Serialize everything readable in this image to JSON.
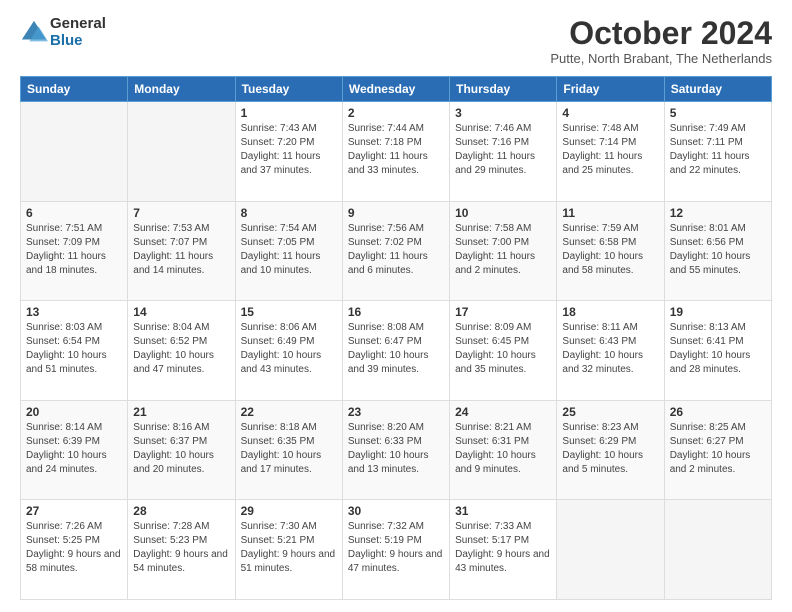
{
  "logo": {
    "general": "General",
    "blue": "Blue"
  },
  "title": "October 2024",
  "subtitle": "Putte, North Brabant, The Netherlands",
  "days_of_week": [
    "Sunday",
    "Monday",
    "Tuesday",
    "Wednesday",
    "Thursday",
    "Friday",
    "Saturday"
  ],
  "weeks": [
    [
      {
        "day": "",
        "sunrise": "",
        "sunset": "",
        "daylight": ""
      },
      {
        "day": "",
        "sunrise": "",
        "sunset": "",
        "daylight": ""
      },
      {
        "day": "1",
        "sunrise": "Sunrise: 7:43 AM",
        "sunset": "Sunset: 7:20 PM",
        "daylight": "Daylight: 11 hours and 37 minutes."
      },
      {
        "day": "2",
        "sunrise": "Sunrise: 7:44 AM",
        "sunset": "Sunset: 7:18 PM",
        "daylight": "Daylight: 11 hours and 33 minutes."
      },
      {
        "day": "3",
        "sunrise": "Sunrise: 7:46 AM",
        "sunset": "Sunset: 7:16 PM",
        "daylight": "Daylight: 11 hours and 29 minutes."
      },
      {
        "day": "4",
        "sunrise": "Sunrise: 7:48 AM",
        "sunset": "Sunset: 7:14 PM",
        "daylight": "Daylight: 11 hours and 25 minutes."
      },
      {
        "day": "5",
        "sunrise": "Sunrise: 7:49 AM",
        "sunset": "Sunset: 7:11 PM",
        "daylight": "Daylight: 11 hours and 22 minutes."
      }
    ],
    [
      {
        "day": "6",
        "sunrise": "Sunrise: 7:51 AM",
        "sunset": "Sunset: 7:09 PM",
        "daylight": "Daylight: 11 hours and 18 minutes."
      },
      {
        "day": "7",
        "sunrise": "Sunrise: 7:53 AM",
        "sunset": "Sunset: 7:07 PM",
        "daylight": "Daylight: 11 hours and 14 minutes."
      },
      {
        "day": "8",
        "sunrise": "Sunrise: 7:54 AM",
        "sunset": "Sunset: 7:05 PM",
        "daylight": "Daylight: 11 hours and 10 minutes."
      },
      {
        "day": "9",
        "sunrise": "Sunrise: 7:56 AM",
        "sunset": "Sunset: 7:02 PM",
        "daylight": "Daylight: 11 hours and 6 minutes."
      },
      {
        "day": "10",
        "sunrise": "Sunrise: 7:58 AM",
        "sunset": "Sunset: 7:00 PM",
        "daylight": "Daylight: 11 hours and 2 minutes."
      },
      {
        "day": "11",
        "sunrise": "Sunrise: 7:59 AM",
        "sunset": "Sunset: 6:58 PM",
        "daylight": "Daylight: 10 hours and 58 minutes."
      },
      {
        "day": "12",
        "sunrise": "Sunrise: 8:01 AM",
        "sunset": "Sunset: 6:56 PM",
        "daylight": "Daylight: 10 hours and 55 minutes."
      }
    ],
    [
      {
        "day": "13",
        "sunrise": "Sunrise: 8:03 AM",
        "sunset": "Sunset: 6:54 PM",
        "daylight": "Daylight: 10 hours and 51 minutes."
      },
      {
        "day": "14",
        "sunrise": "Sunrise: 8:04 AM",
        "sunset": "Sunset: 6:52 PM",
        "daylight": "Daylight: 10 hours and 47 minutes."
      },
      {
        "day": "15",
        "sunrise": "Sunrise: 8:06 AM",
        "sunset": "Sunset: 6:49 PM",
        "daylight": "Daylight: 10 hours and 43 minutes."
      },
      {
        "day": "16",
        "sunrise": "Sunrise: 8:08 AM",
        "sunset": "Sunset: 6:47 PM",
        "daylight": "Daylight: 10 hours and 39 minutes."
      },
      {
        "day": "17",
        "sunrise": "Sunrise: 8:09 AM",
        "sunset": "Sunset: 6:45 PM",
        "daylight": "Daylight: 10 hours and 35 minutes."
      },
      {
        "day": "18",
        "sunrise": "Sunrise: 8:11 AM",
        "sunset": "Sunset: 6:43 PM",
        "daylight": "Daylight: 10 hours and 32 minutes."
      },
      {
        "day": "19",
        "sunrise": "Sunrise: 8:13 AM",
        "sunset": "Sunset: 6:41 PM",
        "daylight": "Daylight: 10 hours and 28 minutes."
      }
    ],
    [
      {
        "day": "20",
        "sunrise": "Sunrise: 8:14 AM",
        "sunset": "Sunset: 6:39 PM",
        "daylight": "Daylight: 10 hours and 24 minutes."
      },
      {
        "day": "21",
        "sunrise": "Sunrise: 8:16 AM",
        "sunset": "Sunset: 6:37 PM",
        "daylight": "Daylight: 10 hours and 20 minutes."
      },
      {
        "day": "22",
        "sunrise": "Sunrise: 8:18 AM",
        "sunset": "Sunset: 6:35 PM",
        "daylight": "Daylight: 10 hours and 17 minutes."
      },
      {
        "day": "23",
        "sunrise": "Sunrise: 8:20 AM",
        "sunset": "Sunset: 6:33 PM",
        "daylight": "Daylight: 10 hours and 13 minutes."
      },
      {
        "day": "24",
        "sunrise": "Sunrise: 8:21 AM",
        "sunset": "Sunset: 6:31 PM",
        "daylight": "Daylight: 10 hours and 9 minutes."
      },
      {
        "day": "25",
        "sunrise": "Sunrise: 8:23 AM",
        "sunset": "Sunset: 6:29 PM",
        "daylight": "Daylight: 10 hours and 5 minutes."
      },
      {
        "day": "26",
        "sunrise": "Sunrise: 8:25 AM",
        "sunset": "Sunset: 6:27 PM",
        "daylight": "Daylight: 10 hours and 2 minutes."
      }
    ],
    [
      {
        "day": "27",
        "sunrise": "Sunrise: 7:26 AM",
        "sunset": "Sunset: 5:25 PM",
        "daylight": "Daylight: 9 hours and 58 minutes."
      },
      {
        "day": "28",
        "sunrise": "Sunrise: 7:28 AM",
        "sunset": "Sunset: 5:23 PM",
        "daylight": "Daylight: 9 hours and 54 minutes."
      },
      {
        "day": "29",
        "sunrise": "Sunrise: 7:30 AM",
        "sunset": "Sunset: 5:21 PM",
        "daylight": "Daylight: 9 hours and 51 minutes."
      },
      {
        "day": "30",
        "sunrise": "Sunrise: 7:32 AM",
        "sunset": "Sunset: 5:19 PM",
        "daylight": "Daylight: 9 hours and 47 minutes."
      },
      {
        "day": "31",
        "sunrise": "Sunrise: 7:33 AM",
        "sunset": "Sunset: 5:17 PM",
        "daylight": "Daylight: 9 hours and 43 minutes."
      },
      {
        "day": "",
        "sunrise": "",
        "sunset": "",
        "daylight": ""
      },
      {
        "day": "",
        "sunrise": "",
        "sunset": "",
        "daylight": ""
      }
    ]
  ]
}
